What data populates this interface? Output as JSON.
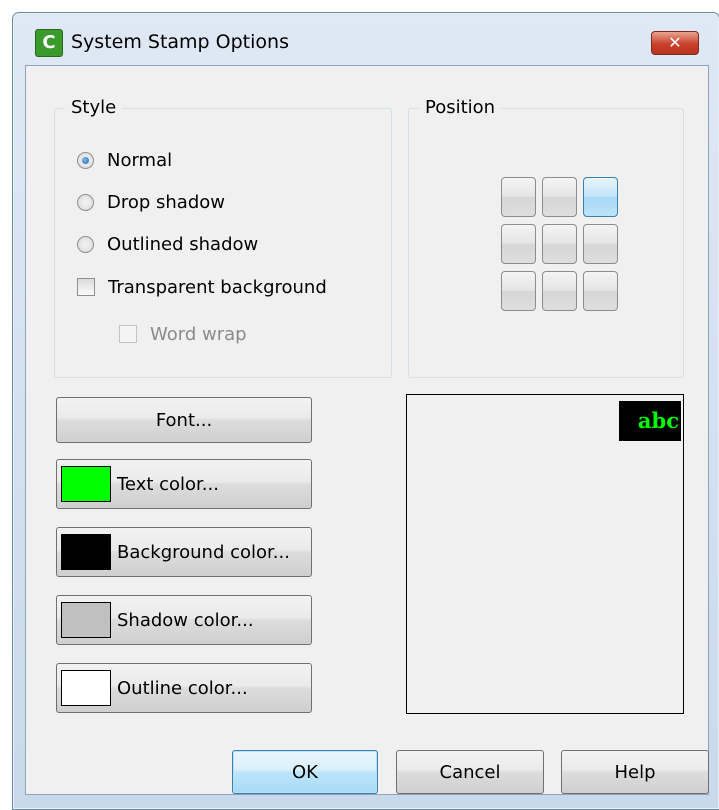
{
  "window": {
    "title": "System Stamp Options",
    "close_label": "✕"
  },
  "style_group": {
    "label": "Style",
    "options": {
      "normal": "Normal",
      "drop_shadow": "Drop shadow",
      "outlined_shadow": "Outlined shadow",
      "selected": "normal"
    },
    "transparent_background": {
      "label": "Transparent background",
      "checked": false
    },
    "word_wrap": {
      "label": "Word wrap",
      "checked": false,
      "enabled": false
    }
  },
  "position_group": {
    "label": "Position",
    "selected_cell": "top-right"
  },
  "buttons": {
    "font": "Font...",
    "text_color": "Text color...",
    "background_color": "Background color...",
    "shadow_color": "Shadow color...",
    "outline_color": "Outline color...",
    "ok": "OK",
    "cancel": "Cancel",
    "help": "Help"
  },
  "colors": {
    "text": "#00ff00",
    "background": "#000000",
    "shadow": "#c0c0c0",
    "outline": "#ffffff"
  },
  "preview": {
    "sample_text": "abc"
  }
}
